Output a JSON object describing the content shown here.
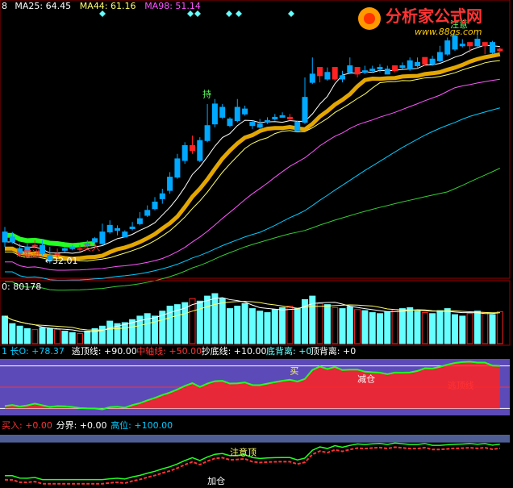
{
  "logo": {
    "text": "分析家公式网",
    "url": "www.88gs.com"
  },
  "colors": {
    "bg": "#000000",
    "frame": "#a00000",
    "up": "#ff2222",
    "down": "#00a8ff",
    "ma25": "#ffffff",
    "ma44": "#ffff66",
    "ma98": "#ff55ff",
    "long": "#00ccff",
    "cyanbar": "#66ffff",
    "ribbon": "#f0b000",
    "green": "#22ff22",
    "indBg": "#5c4ab8",
    "lowBg": "#4e5e94"
  },
  "chart_data": [
    {
      "type": "candlestick",
      "header": [
        {
          "label": "8",
          "color": "#ffffff"
        },
        {
          "label": "MA25: 64.45",
          "color": "#ffffff"
        },
        {
          "label": "MA44: 61.16",
          "color": "#ffff66"
        },
        {
          "label": "MA98: 51.14",
          "color": "#ff55ff"
        }
      ],
      "candles": [
        [
          41.5,
          43.0,
          38.5,
          37.0
        ],
        [
          40.0,
          41.5,
          38.5,
          38.0
        ],
        [
          36.5,
          38.0,
          35.0,
          34.0
        ],
        [
          37.0,
          38.0,
          35.5,
          35.0
        ],
        [
          37.5,
          39.0,
          37.5,
          36.5
        ],
        [
          37.5,
          39.0,
          35.0,
          34.5
        ],
        [
          34.5,
          37.0,
          33.0,
          32.0
        ],
        [
          35.0,
          36.5,
          35.0,
          34.0
        ],
        [
          36.5,
          37.0,
          36.0,
          35.5
        ],
        [
          37.0,
          37.5,
          36.5,
          36.0
        ],
        [
          36.5,
          37.5,
          36.5,
          35.5
        ],
        [
          38.0,
          39.0,
          37.5,
          37.0
        ],
        [
          39.5,
          40.0,
          38.5,
          38.0
        ],
        [
          41.5,
          44.0,
          38.0,
          37.5
        ],
        [
          43.5,
          45.0,
          41.5,
          41.0
        ],
        [
          42.5,
          43.5,
          42.0,
          40.5
        ],
        [
          41.5,
          42.0,
          40.0,
          40.0
        ],
        [
          43.0,
          44.5,
          42.5,
          42.0
        ],
        [
          45.5,
          47.5,
          44.0,
          43.5
        ],
        [
          48.0,
          49.5,
          46.5,
          46.0
        ],
        [
          50.5,
          52.0,
          48.5,
          48.0
        ],
        [
          53.0,
          54.5,
          51.5,
          50.0
        ],
        [
          58.0,
          59.5,
          54.0,
          53.0
        ],
        [
          63.5,
          65.0,
          58.0,
          57.5
        ],
        [
          67.5,
          68.5,
          63.0,
          62.0
        ],
        [
          66.0,
          70.5,
          67.5,
          65.0
        ],
        [
          69.0,
          70.0,
          63.0,
          62.5
        ],
        [
          73.5,
          80.0,
          69.0,
          68.5
        ],
        [
          80.0,
          81.5,
          74.0,
          73.0
        ],
        [
          79.0,
          80.0,
          76.0,
          75.5
        ],
        [
          75.5,
          76.0,
          73.5,
          73.0
        ],
        [
          79.0,
          81.5,
          75.0,
          74.5
        ],
        [
          78.5,
          79.5,
          77.0,
          76.5
        ],
        [
          74.5,
          75.0,
          73.5,
          72.5
        ],
        [
          74.0,
          75.5,
          73.0,
          72.5
        ],
        [
          75.0,
          76.0,
          74.5,
          74.0
        ],
        [
          76.0,
          77.0,
          75.5,
          75.0
        ],
        [
          76.5,
          77.5,
          76.0,
          76.0
        ],
        [
          75.5,
          77.0,
          76.0,
          75.0
        ],
        [
          74.5,
          75.0,
          72.0,
          72.0
        ],
        [
          82.0,
          88.0,
          74.5,
          74.0
        ],
        [
          89.0,
          94.0,
          86.5,
          86.0
        ],
        [
          88.5,
          89.5,
          91.0,
          86.5
        ],
        [
          89.5,
          91.0,
          87.5,
          87.0
        ],
        [
          87.5,
          88.0,
          91.0,
          87.0
        ],
        [
          88.5,
          90.0,
          87.5,
          86.5
        ],
        [
          91.5,
          94.0,
          89.5,
          89.0
        ],
        [
          89.0,
          89.5,
          91.0,
          88.0
        ],
        [
          90.0,
          91.5,
          89.5,
          89.0
        ],
        [
          90.5,
          91.5,
          90.0,
          89.5
        ],
        [
          91.0,
          92.0,
          90.5,
          89.5
        ],
        [
          90.5,
          91.5,
          89.0,
          89.0
        ],
        [
          90.0,
          90.5,
          91.5,
          89.5
        ],
        [
          91.5,
          92.5,
          91.0,
          90.5
        ],
        [
          93.0,
          94.0,
          90.5,
          90.0
        ],
        [
          92.5,
          94.0,
          91.5,
          91.0
        ],
        [
          92.0,
          93.0,
          94.0,
          91.5
        ],
        [
          93.5,
          94.5,
          92.0,
          91.5
        ],
        [
          95.5,
          97.5,
          93.0,
          92.5
        ],
        [
          99.0,
          100.0,
          95.0,
          94.5
        ],
        [
          100.5,
          101.0,
          96.5,
          96.0
        ],
        [
          98.0,
          99.5,
          97.5,
          97.0
        ],
        [
          97.5,
          98.0,
          98.5,
          95.5
        ],
        [
          99.5,
          102.0,
          97.5,
          97.0
        ],
        [
          97.5,
          98.5,
          98.5,
          95.0
        ],
        [
          98.5,
          99.0,
          95.5,
          95.0
        ],
        [
          96.0,
          97.0,
          96.5,
          95.5
        ]
      ],
      "annotations": [
        {
          "text": "★买进",
          "idx": 2,
          "price": 34.0,
          "color": "#ff3333"
        },
        {
          "text": "买入",
          "idx": 11,
          "price": 36.0,
          "color": "#ff3333"
        },
        {
          "text": "←32.01",
          "idx": 6,
          "price": 32.0,
          "color": "#ffffff"
        },
        {
          "text": "注意",
          "idx": 60,
          "price": 103.0,
          "color": "#66ff66"
        },
        {
          "text": "持",
          "idx": 27,
          "price": 82.0,
          "color": "#66ff66"
        }
      ]
    },
    {
      "type": "bar",
      "header": [
        {
          "label": "0: 80178",
          "color": "#ffffff"
        }
      ],
      "volumes": [
        55,
        40,
        35,
        30,
        28,
        32,
        30,
        28,
        25,
        22,
        20,
        25,
        30,
        35,
        45,
        40,
        42,
        48,
        55,
        60,
        55,
        65,
        75,
        78,
        82,
        90,
        85,
        95,
        100,
        90,
        70,
        75,
        80,
        70,
        65,
        62,
        68,
        72,
        75,
        70,
        88,
        95,
        80,
        78,
        72,
        70,
        74,
        68,
        66,
        62,
        60,
        64,
        68,
        70,
        72,
        65,
        62,
        60,
        66,
        70,
        58,
        55,
        60,
        65,
        62,
        58,
        64
      ],
      "ticks": []
    },
    {
      "type": "line",
      "header": [
        {
          "label": "1 长O: +78.37",
          "color": "#00ccff"
        },
        {
          "label": "逃顶线: +90.00",
          "color": "#ffffff"
        },
        {
          "label": "中轴线: +50.00",
          "color": "#ff3333"
        },
        {
          "label": "抄底线: +10.00",
          "color": "#ffffff"
        },
        {
          "label": "底背离: +0",
          "color": "#66ffff"
        },
        {
          "label": "顶背离: +0",
          "color": "#ffffff"
        }
      ],
      "labels": [
        {
          "text": "减仓",
          "idx": 47,
          "value": 60,
          "color": "#ffffff"
        },
        {
          "text": "买",
          "idx": 38,
          "value": 75,
          "color": "#ffff66"
        },
        {
          "text": "逃顶线",
          "idx": 59,
          "value": 48,
          "color": "#ff3333"
        }
      ]
    },
    {
      "type": "line",
      "header": [
        {
          "label": "买入: +0.00",
          "color": "#ff3333"
        },
        {
          "label": "分界: +0.00",
          "color": "#ffffff"
        },
        {
          "label": "高位: +100.00",
          "color": "#00ccff"
        }
      ],
      "labels": [
        {
          "text": "注意顶",
          "idx": 30,
          "value": 60,
          "color": "#ffff66"
        },
        {
          "text": "注意",
          "idx": 69,
          "value": 60,
          "color": "#ffff66"
        },
        {
          "text": "加仓",
          "idx": 27,
          "value": 5,
          "color": "#ffffff"
        }
      ]
    }
  ]
}
